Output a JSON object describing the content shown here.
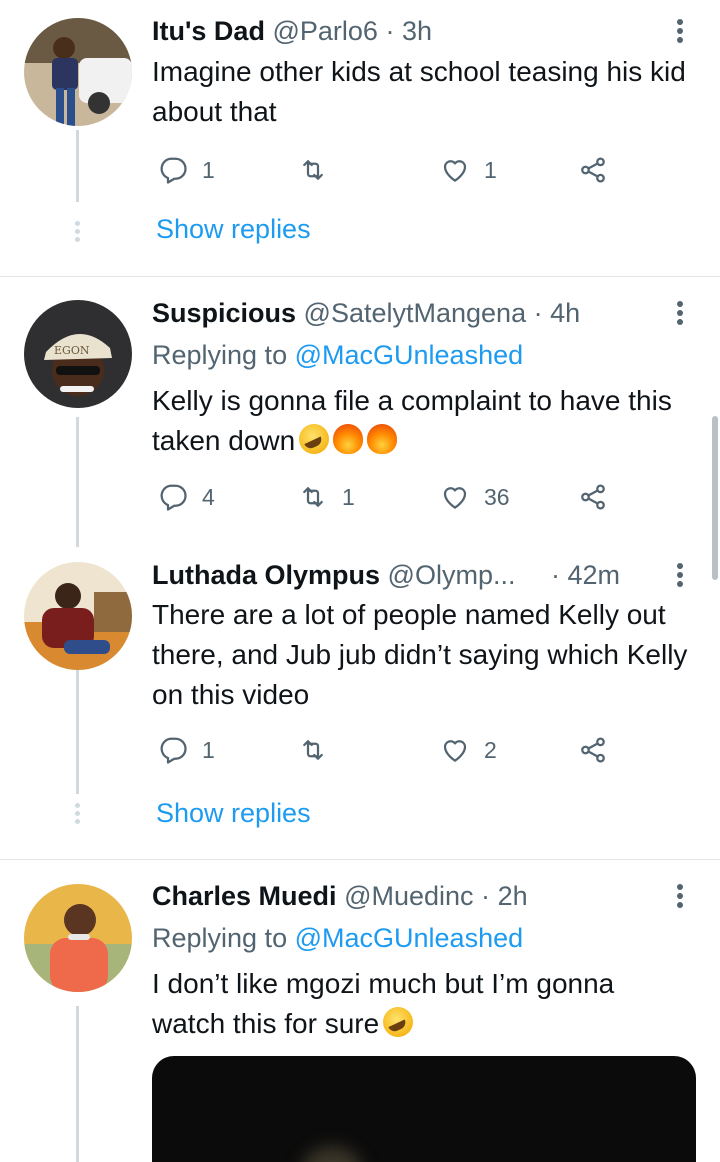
{
  "tweets": [
    {
      "name": "Itu's Dad",
      "handle": "@Parlo6",
      "sep": "·",
      "time": "3h",
      "text": "Imagine other kids at school teasing his kid about that",
      "replies": "1",
      "retweets": "",
      "likes": "1",
      "show_replies": "Show replies"
    },
    {
      "name": "Suspicious",
      "handle": "@SatelytMangena",
      "sep": "·",
      "time": "4h",
      "replying_label": "Replying to",
      "replying_to": "@MacGUnleashed",
      "text": "Kelly is gonna file a complaint to have this taken down",
      "replies": "4",
      "retweets": "1",
      "likes": "36"
    },
    {
      "name": "Luthada Olympus",
      "handle": "@Olymp...",
      "sep": "·",
      "time": "42m",
      "text": "There are a lot of people named Kelly out there, and Jub jub didn’t saying which Kelly on this video",
      "replies": "1",
      "retweets": "",
      "likes": "2",
      "show_replies": "Show replies"
    },
    {
      "name": "Charles Muedi",
      "handle": "@Muedinc",
      "sep": "·",
      "time": "2h",
      "replying_label": "Replying to",
      "replying_to": "@MacGUnleashed",
      "text": "I don’t like mgozi much but I’m gonna watch this for sure"
    }
  ],
  "colors": {
    "accent": "#1d9bf0",
    "muted": "#536471",
    "text": "#0f1419"
  },
  "icons": [
    "reply-icon",
    "retweet-icon",
    "like-icon",
    "share-icon",
    "more-icon"
  ]
}
